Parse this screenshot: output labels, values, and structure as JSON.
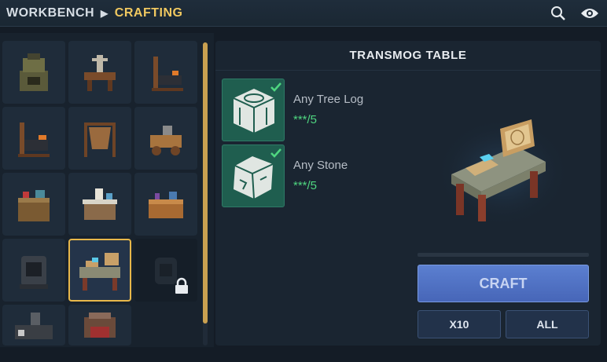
{
  "header": {
    "breadcrumb_root": "WORKBENCH",
    "breadcrumb_current": "CRAFTING",
    "search_icon": "search-icon",
    "visibility_icon": "eye-icon"
  },
  "recipe": {
    "title": "TRANSMOG TABLE",
    "ingredients": [
      {
        "name": "Any Tree Log",
        "count": "***/5",
        "icon": "tree-log-icon"
      },
      {
        "name": "Any Stone",
        "count": "***/5",
        "icon": "stone-icon"
      }
    ],
    "progress": 0
  },
  "actions": {
    "craft_label": "CRAFT",
    "x10_label": "X10",
    "all_label": "ALL"
  },
  "colors": {
    "accent": "#f0c860",
    "craft": "#5b7fd0",
    "ingredient_bg": "#1f5e4f",
    "count_ok": "#4fd680"
  }
}
